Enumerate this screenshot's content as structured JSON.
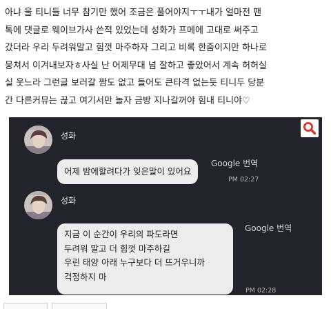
{
  "post": {
    "body": "아냐 울 티니들 너무 참기만 했어 조금은 풀어야지ㅜㅜ내가 얼마전 팬\n톡에 댓글로 웨이브가사 쓴적 있었는데 성화가 프메에 고대로 써주고\n갔더라 우리 두려워말고 힘껏 마주하자 그리고 비록 한줌이지만 하나로\n뭉쳐서 이겨내보자ㅎ사실 난 어제무대 넘 잘하고 좋았어서 계속 허허실\n실 웃느라 그런글 보러갈 짬도 없고 들어도 큰타격 없는듯 티니두 당분\n간 다른커뮤는 끊고 여기서만 놀자 금방 지나갈꺼야 힘내 티니야♡"
  },
  "screenshot": {
    "colors": {
      "background": "#22232b",
      "bubble": "#ececec",
      "search_icon": "#d9342b"
    },
    "icons": {
      "search": "search-icon"
    },
    "messages": [
      {
        "sender": "성화",
        "text": "어제 밤에할려다가 잊은말이 있어요",
        "translate": "Google 번역",
        "time": "PM 02:27"
      },
      {
        "sender": "성화",
        "text": "지금 이 순간이 우리의 파도라면\n두려워 말고 더 힘껏 마주하길\n우린 태양 아래 누구보다 더 뜨거우니까\n걱정하지 마",
        "translate": "Google 번역",
        "time": "PM 02:28"
      }
    ]
  }
}
